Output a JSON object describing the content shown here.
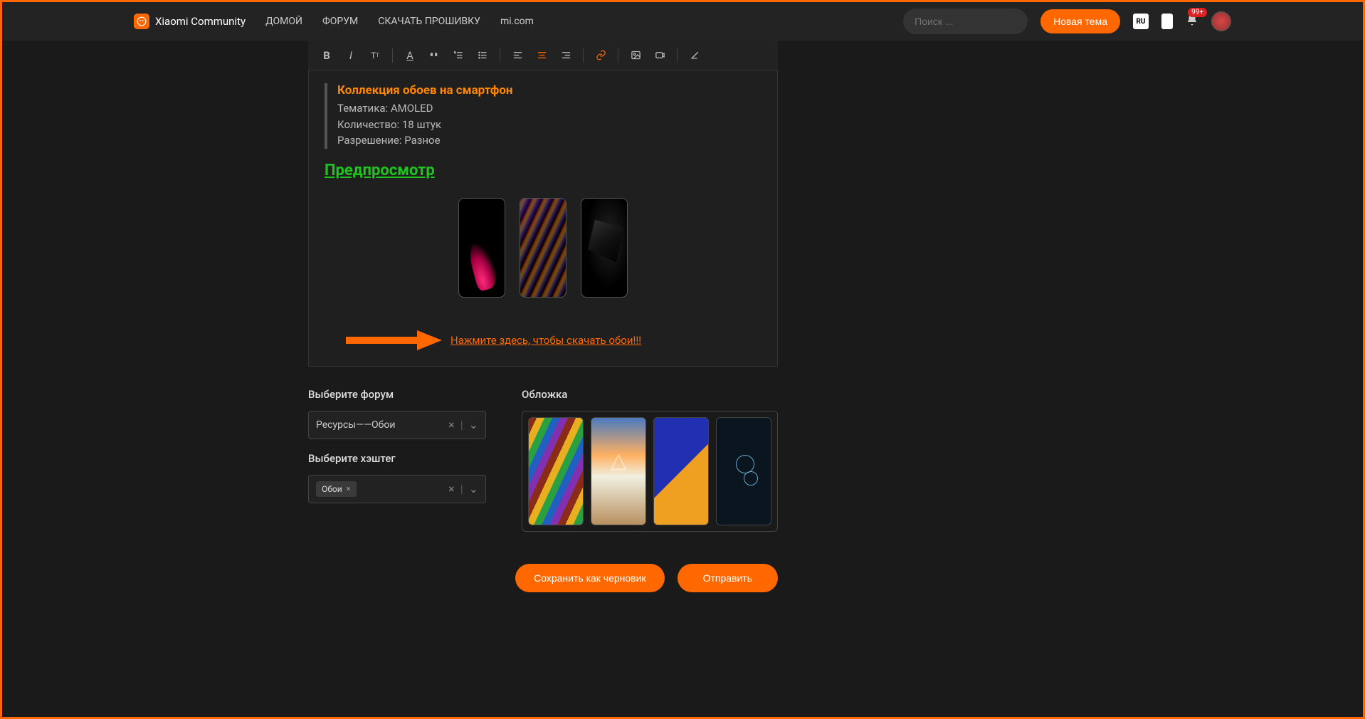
{
  "header": {
    "brand": "Xiaomi Community",
    "nav": [
      "ДОМОЙ",
      "ФОРУМ",
      "СКАЧАТЬ ПРОШИВКУ",
      "mi.com"
    ],
    "search_placeholder": "Поиск ...",
    "new_topic": "Новая тема",
    "lang": "RU",
    "badge": "99+"
  },
  "toolbar": {
    "bold": "B",
    "italic": "I",
    "size": "T",
    "underline": "A",
    "quote": "❝",
    "ol": "≡",
    "ul": "⋮≡",
    "align_left": "≡",
    "align_center": "≡",
    "align_right": "≡",
    "link": "🔗",
    "image": "🖼",
    "video": "▭",
    "clear": "◇"
  },
  "editor": {
    "quote_title": "Коллекция обоев на смартфон",
    "lines": [
      "Тематика: AMOLED",
      "Количество: 18 штук",
      "Разрешение: Разное"
    ],
    "preview_heading": "Предпросмотр",
    "download_link": "Нажмите здесь, чтобы скачать обои!!!"
  },
  "form": {
    "forum_label": "Выберите форум",
    "forum_value": "Ресурсы——Обои",
    "hashtag_label": "Выберите хэштег",
    "hashtag_value": "Обои",
    "cover_label": "Обложка"
  },
  "buttons": {
    "save_draft": "Сохранить как черновик",
    "submit": "Отправить"
  }
}
